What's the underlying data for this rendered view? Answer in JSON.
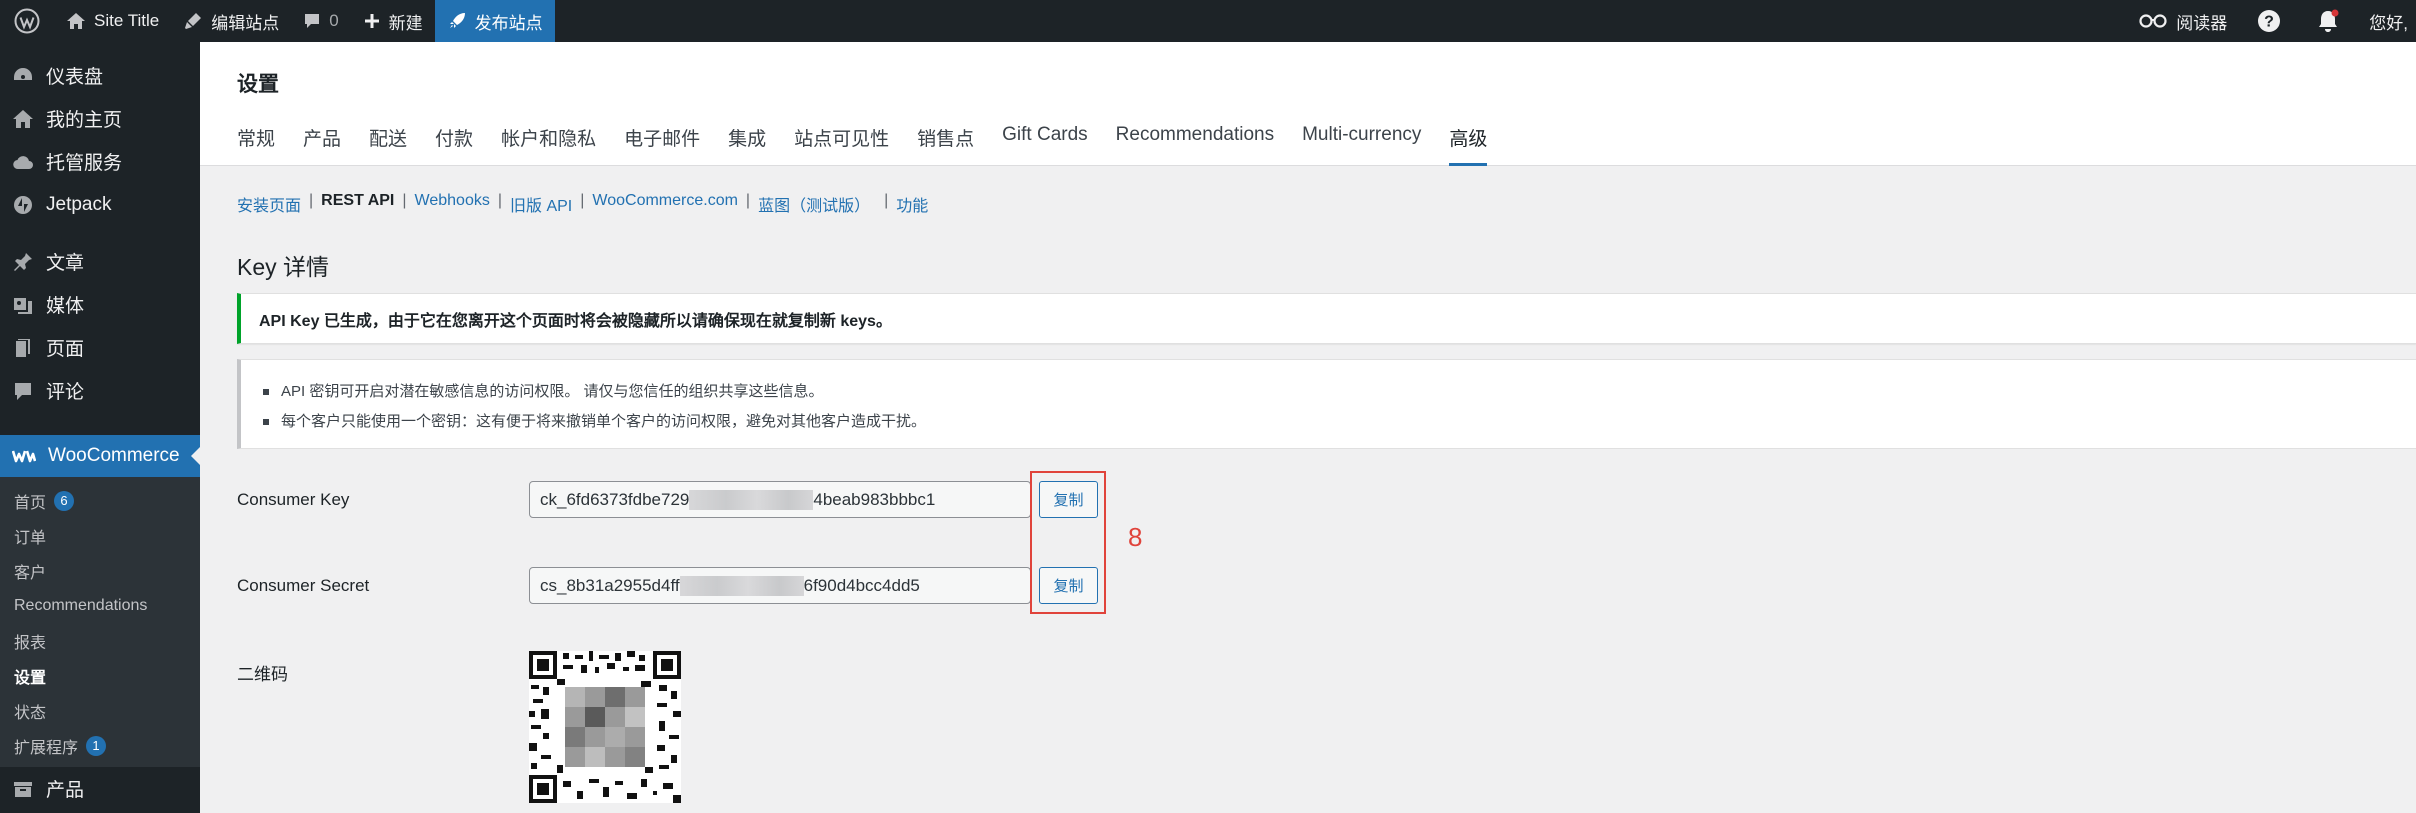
{
  "adminbar": {
    "site_title": "Site Title",
    "edit_site": "编辑站点",
    "comments_count": "0",
    "new": "新建",
    "publish": "发布站点",
    "reader": "阅读器",
    "greeting": "您好,"
  },
  "sidebar": {
    "items": [
      {
        "label": "仪表盘",
        "icon": "dashboard-icon"
      },
      {
        "label": "我的主页",
        "icon": "home-icon"
      },
      {
        "label": "托管服务",
        "icon": "cloud-icon"
      },
      {
        "label": "Jetpack",
        "icon": "jetpack-icon"
      },
      {
        "label": "文章",
        "icon": "pin-icon"
      },
      {
        "label": "媒体",
        "icon": "media-icon"
      },
      {
        "label": "页面",
        "icon": "page-icon"
      },
      {
        "label": "评论",
        "icon": "comment-icon"
      }
    ],
    "woocommerce": "WooCommerce",
    "submenu": [
      {
        "label": "首页",
        "badge": "6"
      },
      {
        "label": "订单"
      },
      {
        "label": "客户"
      },
      {
        "label": "Recommendations"
      },
      {
        "label": "报表"
      },
      {
        "label": "设置",
        "current": true
      },
      {
        "label": "状态"
      },
      {
        "label": "扩展程序",
        "badge": "1"
      }
    ],
    "products": "产品"
  },
  "header": {
    "title": "设置",
    "tabs": [
      "常规",
      "产品",
      "配送",
      "付款",
      "帐户和隐私",
      "电子邮件",
      "集成",
      "站点可见性",
      "销售点",
      "Gift Cards",
      "Recommendations",
      "Multi-currency",
      "高级"
    ],
    "active_tab": "高级"
  },
  "subnav": {
    "items": [
      "安装页面",
      "REST API",
      "Webhooks",
      "旧版 API",
      "WooCommerce.com",
      "蓝图（测试版）",
      "功能"
    ],
    "current": "REST API"
  },
  "key_details": {
    "title": "Key 详情",
    "success_notice": "API Key 已生成，由于它在您离开这个页面时将会被隐藏所以请确保现在就复制新 keys。",
    "info_items": [
      "API 密钥可开启对潜在敏感信息的访问权限。 请仅与您信任的组织共享这些信息。",
      "每个客户只能使用一个密钥：这有便于将来撤销单个客户的访问权限，避免对其他客户造成干扰。"
    ],
    "consumer_key_label": "Consumer Key",
    "consumer_key_start": "ck_6fd6373fdbe729",
    "consumer_key_end": "4beab983bbbc1",
    "consumer_secret_label": "Consumer Secret",
    "consumer_secret_start": "cs_8b31a2955d4ff",
    "consumer_secret_end": "6f90d4bcc4dd5",
    "copy_label": "复制",
    "qr_label": "二维码"
  },
  "annotation": {
    "number": "8",
    "color": "#e0433b"
  }
}
